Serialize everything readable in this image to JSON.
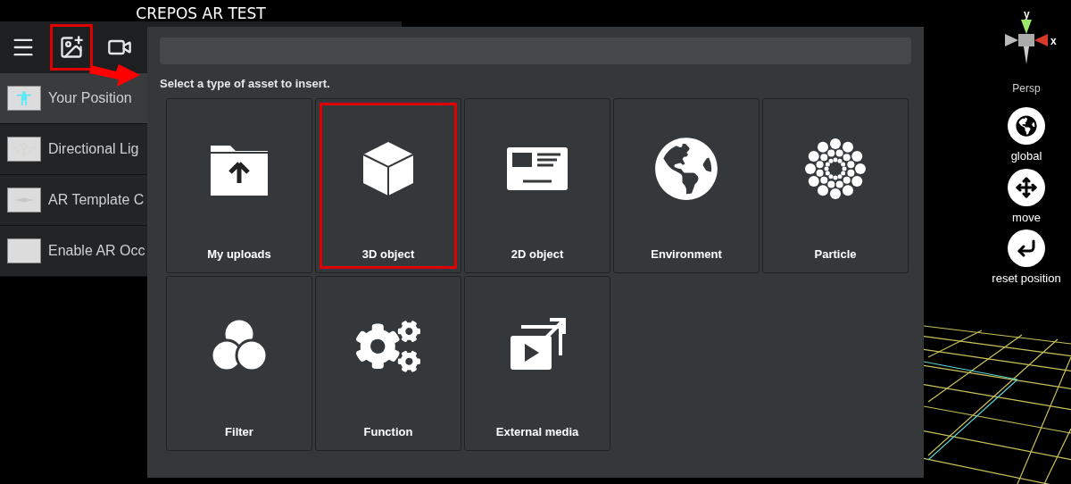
{
  "window": {
    "title": "CREPOS AR TEST"
  },
  "toolbar": [
    {
      "kind": "menu",
      "highlighted": false
    },
    {
      "kind": "add-image",
      "highlighted": true
    },
    {
      "kind": "video",
      "highlighted": false
    }
  ],
  "scene_items": [
    {
      "label": "Your Position",
      "kind": "person",
      "selected": true
    },
    {
      "label": "Directional Lig",
      "kind": "light",
      "selected": false
    },
    {
      "label": "AR Template C",
      "kind": "plane",
      "selected": false
    },
    {
      "label": "Enable AR Occ",
      "kind": "blank",
      "selected": false
    }
  ],
  "dialog": {
    "instruction": "Select a type of asset to insert.",
    "tiles": [
      {
        "label": "My uploads",
        "kind": "uploads",
        "highlighted": false
      },
      {
        "label": "3D object",
        "kind": "cube",
        "highlighted": true
      },
      {
        "label": "2D object",
        "kind": "card",
        "highlighted": false
      },
      {
        "label": "Environment",
        "kind": "globe",
        "highlighted": false
      },
      {
        "label": "Particle",
        "kind": "particle",
        "highlighted": false
      },
      {
        "label": "Filter",
        "kind": "filter",
        "highlighted": false
      },
      {
        "label": "Function",
        "kind": "gears",
        "highlighted": false
      },
      {
        "label": "External media",
        "kind": "media",
        "highlighted": false
      }
    ]
  },
  "viewport": {
    "gizmo": {
      "y_label": "y",
      "x_label": "x",
      "view": "Persp"
    },
    "tools": [
      {
        "label": "global",
        "kind": "globe"
      },
      {
        "label": "move",
        "kind": "move"
      },
      {
        "label": "reset position",
        "kind": "reset"
      }
    ]
  }
}
